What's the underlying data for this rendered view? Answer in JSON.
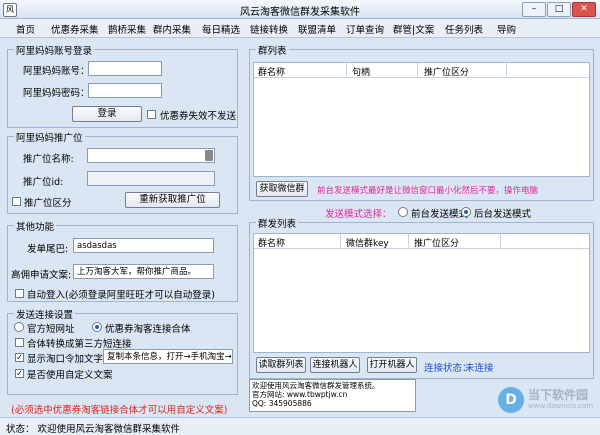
{
  "window": {
    "title": "风云淘客微信群发采集软件",
    "icon_char": "风"
  },
  "menu": [
    "首页",
    "优惠券采集",
    "鹊桥采集",
    "群内采集",
    "每日精选",
    "链接转换",
    "联盟清单",
    "订单查询",
    "群管|文案",
    "任务列表",
    "导购"
  ],
  "login": {
    "title": "阿里妈妈账号登录",
    "account_label": "阿里妈妈账号：",
    "password_label": "阿里妈妈密码：",
    "login_button": "登录",
    "coupon_invalid_label": "优惠券失效不发送"
  },
  "promo": {
    "title": "阿里妈妈推广位",
    "name_label": "推广位名称:",
    "id_label": "推广位id:",
    "split_label": "推广位区分",
    "refetch_button": "重新获取推广位"
  },
  "other": {
    "title": "其他功能",
    "tail_label": "发单尾巴:",
    "tail_value": "asdasdas",
    "apply_label": "高佣申请文案:",
    "apply_value": "上万淘客大军，帮你推广商品。",
    "auto_login_label": "自动登入(必须登录阿里旺旺才可以自动登录)"
  },
  "send": {
    "title": "发送连接设置",
    "official_short": "官方短网址",
    "coupon_combo": "优惠券淘客连接合体",
    "third_party_short": "合体转换成第三方短连接",
    "show_taoword": "显示淘口令加文字",
    "taoword_value": "复制本条信息，打开→手机淘宝→",
    "custom_text": "是否使用自定义文案",
    "note": "(必须选中优惠券淘客链接合体才可以用自定义文案)"
  },
  "group_list": {
    "title": "群列表",
    "columns": [
      "群名称",
      "句柄",
      "推广位区分"
    ],
    "fetch_button": "获取微信群",
    "hint": "前台发送模式最好是让微信窗口最小化然后不要，操作电脑"
  },
  "send_mode": {
    "label": "发送模式选择：",
    "front": "前台发送模式",
    "back": "后台发送模式"
  },
  "send_list": {
    "title": "群发列表",
    "columns": [
      "群名称",
      "微信群key",
      "推广位区分"
    ],
    "read_button": "读取群列表",
    "connect_button": "连接机器人",
    "open_button": "打开机器人",
    "status_label": "连接状态：",
    "status_value": "未连接"
  },
  "log": {
    "line1": "欢迎使用风云淘客微信群发管理系统。",
    "line2": "官方网站: www.tbwptjw.cn",
    "line3": "QQ: 345905886"
  },
  "statusbar": {
    "text": "状态：  欢迎使用风云淘客微信群采集软件"
  },
  "watermark": {
    "logo": "D",
    "line1": "当下软件园",
    "line2": "www.downxia.com"
  },
  "colors": {
    "accent_magenta": "#e0279a",
    "status_blue": "#1a4fc9",
    "note_red": "#d8261c"
  }
}
